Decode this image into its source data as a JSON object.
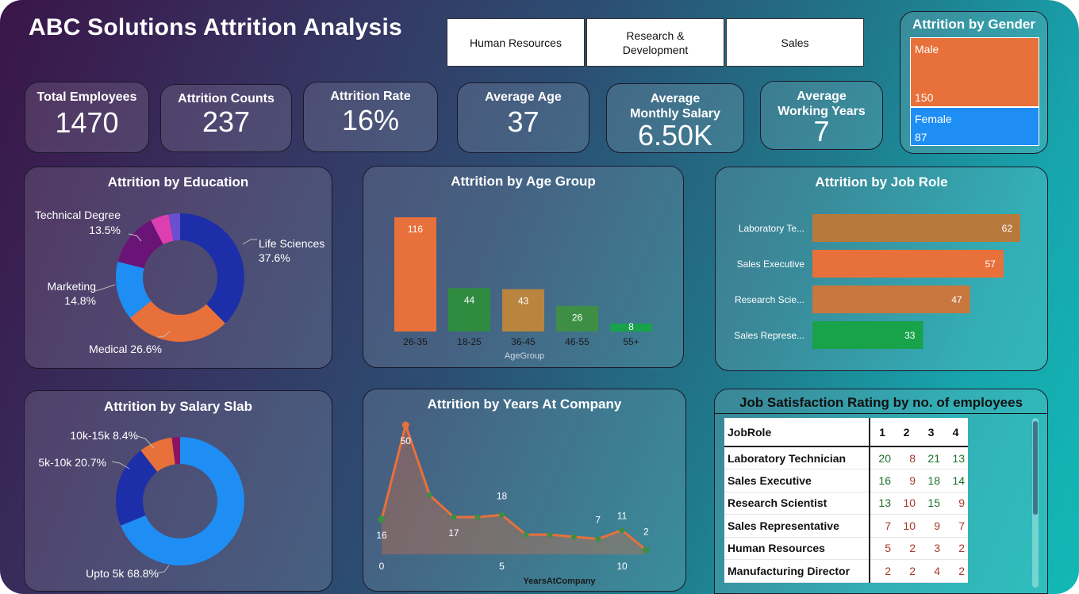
{
  "title": "ABC Solutions Attrition Analysis",
  "departments": [
    "Human Resources",
    "Research & Development",
    "Sales"
  ],
  "kpis": [
    {
      "label": "Total Employees",
      "value": "1470"
    },
    {
      "label": "Attrition Counts",
      "value": "237"
    },
    {
      "label": "Attrition Rate",
      "value": "16%"
    },
    {
      "label": "Average Age",
      "value": "37"
    },
    {
      "label": "Average Monthly Salary",
      "value": "6.50K"
    },
    {
      "label": "Average Working Years",
      "value": "7"
    }
  ],
  "gender": {
    "title": "Attrition by Gender",
    "items": [
      {
        "label": "Male",
        "value": "150",
        "color": "#E8703A"
      },
      {
        "label": "Female",
        "value": "87",
        "color": "#1E8EF5"
      }
    ]
  },
  "education": {
    "title": "Attrition by Education",
    "labels": [
      {
        "name": "Life Sciences",
        "pct": "37.6%"
      },
      {
        "name": "Medical 26.6%"
      },
      {
        "name": "Marketing",
        "pct": "14.8%"
      },
      {
        "name": "Technical Degree",
        "pct": "13.5%"
      }
    ]
  },
  "age": {
    "title": "Attrition by Age Group",
    "axis_title": "AgeGroup"
  },
  "jobrole": {
    "title": "Attrition by Job Role"
  },
  "salary": {
    "title": "Attrition by Salary Slab",
    "labels": [
      "10k-15k 8.4%",
      "5k-10k 20.7%",
      "Upto 5k 68.8%"
    ]
  },
  "years": {
    "title": "Attrition by Years At Company",
    "axis_title": "YearsAtCompany"
  },
  "satisfaction": {
    "title": "Job Satisfaction Rating by no. of employees",
    "header": [
      "JobRole",
      "1",
      "2",
      "3",
      "4"
    ],
    "rows": [
      {
        "role": "Laboratory Technician",
        "values": [
          "20",
          "8",
          "21",
          "13"
        ]
      },
      {
        "role": "Sales Executive",
        "values": [
          "16",
          "9",
          "18",
          "14"
        ]
      },
      {
        "role": "Research Scientist",
        "values": [
          "13",
          "10",
          "15",
          "9"
        ]
      },
      {
        "role": "Sales Representative",
        "values": [
          "7",
          "10",
          "9",
          "7"
        ]
      },
      {
        "role": "Human Resources",
        "values": [
          "5",
          "2",
          "3",
          "2"
        ]
      },
      {
        "role": "Manufacturing Director",
        "values": [
          "2",
          "2",
          "4",
          "2"
        ]
      }
    ]
  },
  "chart_data": [
    {
      "type": "pie",
      "title": "Attrition by Education",
      "slices": [
        {
          "label": "Life Sciences",
          "value": 37.6,
          "color": "#1C2FA8"
        },
        {
          "label": "Medical",
          "value": 26.6,
          "color": "#E8703A"
        },
        {
          "label": "Marketing",
          "value": 14.8,
          "color": "#1E8EF5"
        },
        {
          "label": "Technical Degree",
          "value": 13.5,
          "color": "#6B1478"
        },
        {
          "label": "",
          "value": 4.6,
          "color": "#DE3FB0"
        },
        {
          "label": "",
          "value": 2.9,
          "color": "#6A4FD0"
        }
      ]
    },
    {
      "type": "bar",
      "title": "Attrition by Age Group",
      "xlabel": "AgeGroup",
      "categories": [
        "26-35",
        "18-25",
        "36-45",
        "46-55",
        "55+"
      ],
      "values": [
        116,
        44,
        43,
        26,
        8
      ],
      "colors": [
        "#E8703A",
        "#2E8B40",
        "#B8843E",
        "#3E8E45",
        "#18A24A"
      ]
    },
    {
      "type": "bar",
      "orientation": "horizontal",
      "title": "Attrition by Job Role",
      "categories": [
        "Laboratory Te...",
        "Sales Executive",
        "Research Scie...",
        "Sales Represe..."
      ],
      "values": [
        62,
        57,
        47,
        33
      ],
      "colors": [
        "#B87A3C",
        "#E8703A",
        "#C8773E",
        "#18A24A"
      ]
    },
    {
      "type": "pie",
      "title": "Attrition by Salary Slab",
      "slices": [
        {
          "label": "Upto 5k",
          "value": 68.8,
          "color": "#1E8EF5"
        },
        {
          "label": "5k-10k",
          "value": 20.7,
          "color": "#1C2FA8"
        },
        {
          "label": "10k-15k",
          "value": 8.4,
          "color": "#E8703A"
        },
        {
          "label": "",
          "value": 2.1,
          "color": "#8A1462"
        }
      ]
    },
    {
      "type": "area",
      "title": "Attrition by Years At Company",
      "xlabel": "YearsAtCompany",
      "x": [
        0,
        1,
        2,
        3,
        4,
        5,
        6,
        7,
        8,
        9,
        10,
        11
      ],
      "y": [
        16,
        59,
        27,
        17,
        17,
        18,
        9,
        9,
        8,
        7,
        11,
        2
      ],
      "data_labels": [
        {
          "x": 0,
          "text": "16"
        },
        {
          "x": 1,
          "text": "50"
        },
        {
          "x": 3,
          "text": "17"
        },
        {
          "x": 5,
          "text": "18"
        },
        {
          "x": 9,
          "text": "7"
        },
        {
          "x": 10,
          "text": "11"
        },
        {
          "x": 11,
          "text": "2"
        }
      ],
      "x_ticks": [
        "0",
        "5",
        "10"
      ],
      "line_color": "#E8703A",
      "point_color": "#3E8E45"
    }
  ]
}
